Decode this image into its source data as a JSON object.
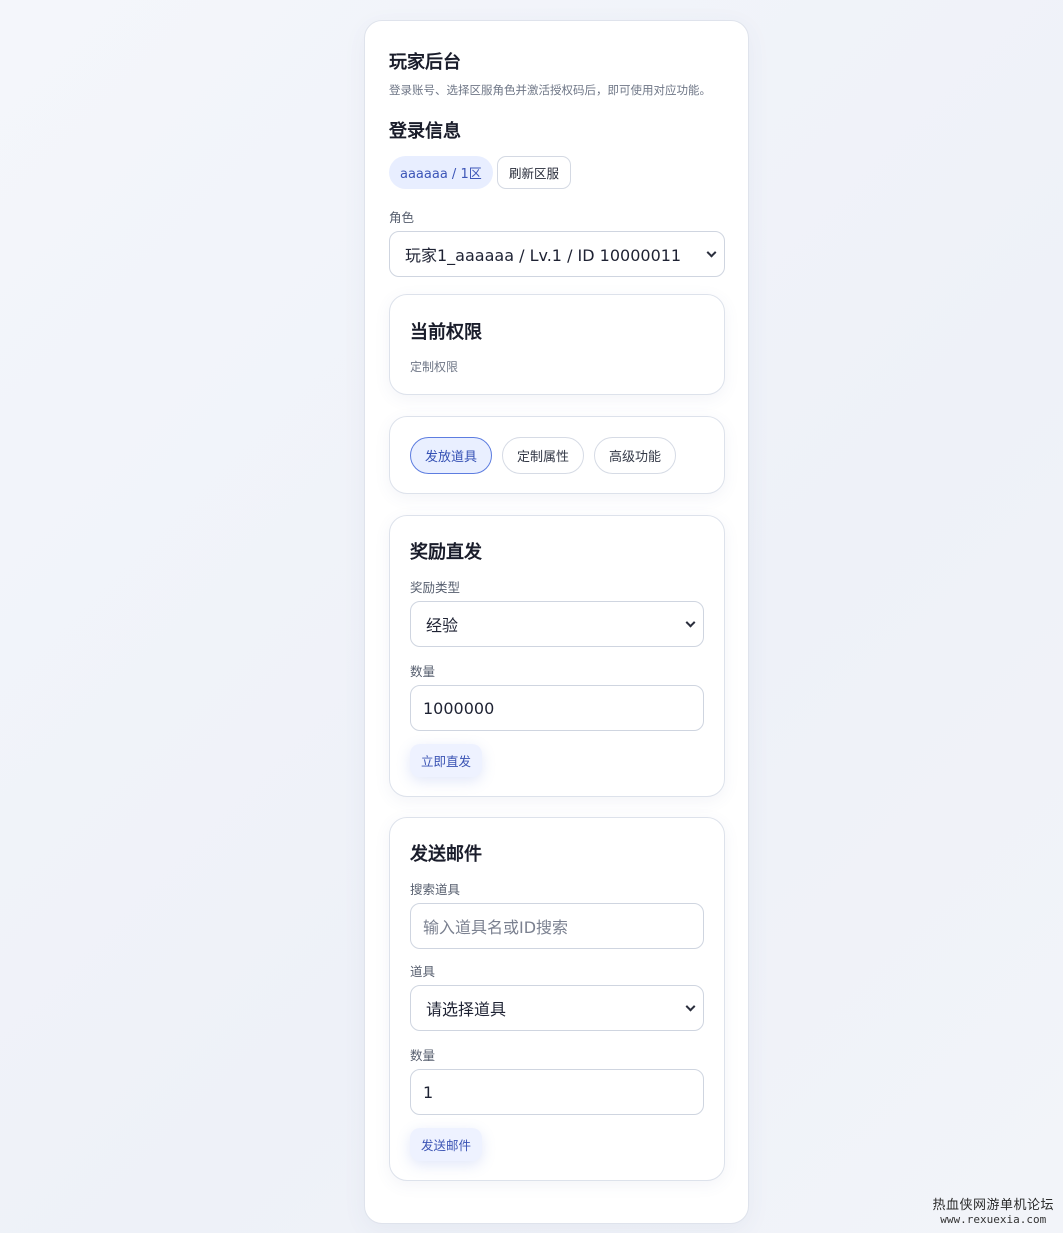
{
  "header": {
    "title": "玩家后台",
    "subtitle": "登录账号、选择区服角色并激活授权码后，即可使用对应功能。"
  },
  "login": {
    "section_title": "登录信息",
    "account_chip": "aaaaaa / 1区",
    "refresh_label": "刷新区服",
    "role_label": "角色",
    "role_selected": "玩家1_aaaaaa / Lv.1 / ID 10000011"
  },
  "permission": {
    "title": "当前权限",
    "value": "定制权限"
  },
  "tabs": [
    {
      "label": "发放道具",
      "active": true
    },
    {
      "label": "定制属性",
      "active": false
    },
    {
      "label": "高级功能",
      "active": false
    }
  ],
  "reward": {
    "title": "奖励直发",
    "type_label": "奖励类型",
    "type_selected": "经验",
    "amount_label": "数量",
    "amount_value": "1000000",
    "submit_label": "立即直发"
  },
  "mail": {
    "title": "发送邮件",
    "search_label": "搜索道具",
    "search_placeholder": "输入道具名或ID搜索",
    "item_label": "道具",
    "item_selected": "请选择道具",
    "amount_label": "数量",
    "amount_value": "1",
    "submit_label": "发送邮件"
  },
  "watermark": {
    "line1": "热血侠网游单机论坛",
    "line2": "www.rexuexia.com"
  },
  "colors": {
    "accent": "#3d56b8",
    "accent_bg": "#e9efff",
    "border": "#dde2eb"
  }
}
